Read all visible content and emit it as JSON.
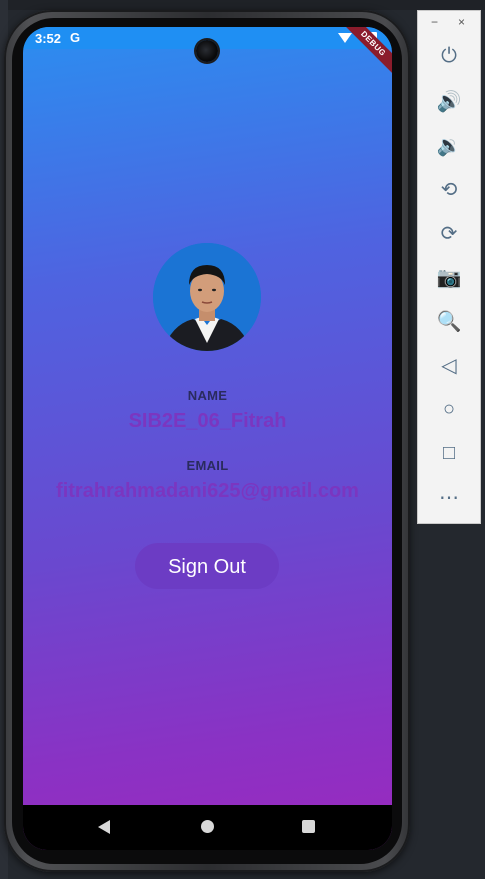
{
  "status_bar": {
    "time": "3:52",
    "google_badge": "G"
  },
  "debug_banner": "DEBUG",
  "profile": {
    "name_label": "NAME",
    "name_value": "SIB2E_06_Fitrah",
    "email_label": "EMAIL",
    "email_value": "fitrahrahmadani625@gmail.com"
  },
  "actions": {
    "sign_out": "Sign Out"
  },
  "emulator": {
    "minimize": "−",
    "close": "×",
    "controls": [
      {
        "name": "power-icon",
        "glyph": "⏻"
      },
      {
        "name": "volume-up-icon",
        "glyph": "🔊"
      },
      {
        "name": "volume-down-icon",
        "glyph": "🔉"
      },
      {
        "name": "rotate-left-icon",
        "glyph": "⟲"
      },
      {
        "name": "rotate-right-icon",
        "glyph": "⟳"
      },
      {
        "name": "camera-icon",
        "glyph": "📷"
      },
      {
        "name": "zoom-icon",
        "glyph": "🔍"
      },
      {
        "name": "back-icon",
        "glyph": "◁"
      },
      {
        "name": "home-icon",
        "glyph": "○"
      },
      {
        "name": "overview-icon",
        "glyph": "□"
      },
      {
        "name": "more-icon",
        "glyph": "⋯"
      }
    ]
  },
  "colors": {
    "gradient_top": "#2b8ef0",
    "gradient_bottom": "#9b29be",
    "name_color": "#7b36c0",
    "button_bg": "#6c3cc4"
  }
}
